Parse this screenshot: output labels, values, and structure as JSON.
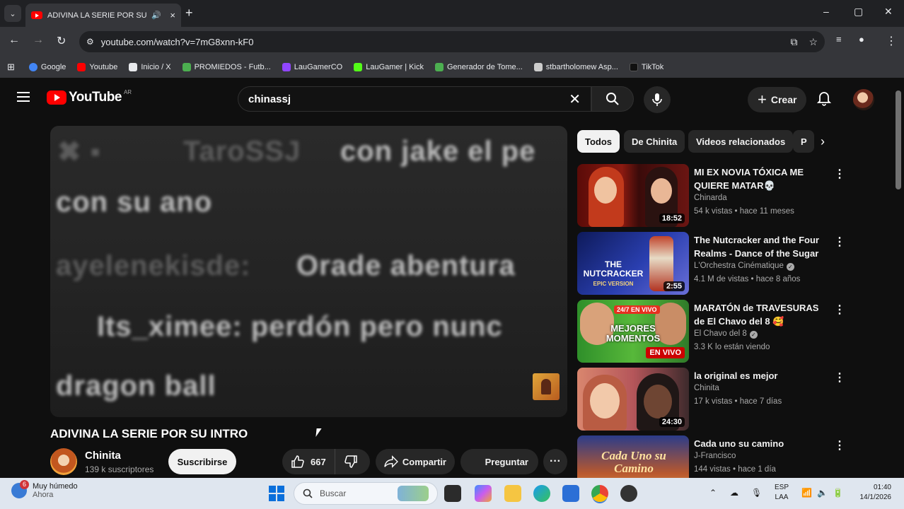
{
  "browser": {
    "tab": {
      "title": "ADIVINA LA SERIE POR SU INTRO",
      "audio_icon": "speaker-icon",
      "close": "×"
    },
    "new_tab": "+",
    "window_controls": [
      "–",
      "▢",
      "✕"
    ],
    "url": "youtube.com/watch?v=7mG8xnn-kF0",
    "bookmarks": [
      {
        "label": "Google",
        "color": "#4285f4"
      },
      {
        "label": "Youtube",
        "color": "#ff0000"
      },
      {
        "label": "Inicio / X",
        "color": "#e8eaed"
      },
      {
        "label": "PROMIEDOS - Futb...",
        "color": "#4caf50"
      },
      {
        "label": "LauGamerCO",
        "color": "#9146ff"
      },
      {
        "label": "LauGamer | Kick",
        "color": "#53fc18"
      },
      {
        "label": "Generador de Tome...",
        "color": "#4caf50"
      },
      {
        "label": "stbartholomew Asp...",
        "color": "#cccccc"
      },
      {
        "label": "TikTok",
        "color": "#222222"
      }
    ]
  },
  "youtube": {
    "logo_text": "YouTube",
    "country": "AR",
    "search_value": "chinassj",
    "create_label": "Crear",
    "player_chat": [
      {
        "text": "TaroSSJ",
        "dim": true
      },
      {
        "text": "con jake el pe"
      },
      {
        "text": "con su ano"
      },
      {
        "text": "ayelenekisde:",
        "dim": true
      },
      {
        "text": "Orade abentura"
      },
      {
        "text": "Its_ximee: perdón pero nunc"
      },
      {
        "text": "dragon ball"
      }
    ],
    "video_title": "ADIVINA LA SERIE POR SU INTRO",
    "channel": {
      "name": "Chinita",
      "subs": "139 k suscriptores"
    },
    "subscribe_label": "Suscribirse",
    "likes": "667",
    "share_label": "Compartir",
    "ask_label": "Preguntar",
    "chips": [
      "Todos",
      "De Chinita",
      "Videos relacionados",
      "P"
    ],
    "recommendations": [
      {
        "title": "MI EX NOVIA TÓXICA ME QUIERE MATAR💀",
        "channel": "Chinarda",
        "meta": "54 k vistas • hace 11 meses",
        "duration": "18:52",
        "verified": false
      },
      {
        "title": "The Nutcracker and the Four Realms - Dance of the Sugar ...",
        "channel": "L'Orchestra Cinématique",
        "meta": "4.1 M de vistas • hace 8 años",
        "duration": "2:55",
        "verified": true
      },
      {
        "title": "MARATÓN de TRAVESURAS de El Chavo del 8 🥰",
        "channel": "El Chavo del 8",
        "meta": "3.3 K lo están viendo",
        "duration": "EN VIVO",
        "verified": true
      },
      {
        "title": "la original es mejor",
        "channel": "Chinita",
        "meta": "17 k vistas • hace 7 días",
        "duration": "24:30",
        "verified": false
      },
      {
        "title": "Cada uno su camino",
        "channel": "J-Francisco",
        "meta": "144 vistas • hace 1 día",
        "duration": "",
        "verified": false
      }
    ],
    "thumb_text": {
      "nutcracker": "THE NUTCRACKER",
      "nutcracker_sub": "EPIC VERSION",
      "chavo_top": "24/7 EN VIVO",
      "chavo_mid": "MEJORES MOMENTOS",
      "cada": "Cada Uno su Camino"
    }
  },
  "taskbar": {
    "weather_line1": "Muy húmedo",
    "weather_line2": "Ahora",
    "weather_badge": "6",
    "search_placeholder": "Buscar",
    "lang_line1": "ESP",
    "lang_line2": "LAA",
    "time": "01:40",
    "date": "14/1/2026"
  }
}
